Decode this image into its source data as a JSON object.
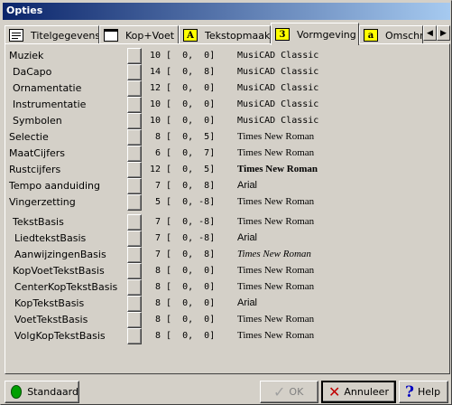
{
  "window": {
    "title": "Opties"
  },
  "tabs": [
    {
      "label": "Titelgegevens",
      "icon": "book-icon"
    },
    {
      "label": "Kop+Voet",
      "icon": "folder-icon"
    },
    {
      "label": "Tekstopmaak",
      "icon": "text-icon",
      "glyph": "A"
    },
    {
      "label": "Vormgeving",
      "icon": "layout-icon",
      "glyph": "3",
      "active": true
    },
    {
      "label": "Omschrij",
      "icon": "description-icon",
      "glyph": "a"
    }
  ],
  "rows": [
    {
      "name": "muziek",
      "label": "Muziek",
      "size": "10",
      "bracket": "[  0,  0]",
      "font": "MusiCAD Classic",
      "style": "mono"
    },
    {
      "name": "dacapo",
      "label": "DaCapo",
      "size": "14",
      "bracket": "[  0,  8]",
      "font": "MusiCAD Classic",
      "style": "mono"
    },
    {
      "name": "ornamentatie",
      "label": "Ornamentatie",
      "size": "12",
      "bracket": "[  0,  0]",
      "font": "MusiCAD Classic",
      "style": "mono"
    },
    {
      "name": "instrumentatie",
      "label": "Instrumentatie",
      "size": "10",
      "bracket": "[  0,  0]",
      "font": "MusiCAD Classic",
      "style": "mono"
    },
    {
      "name": "symbolen",
      "label": "Symbolen",
      "size": "10",
      "bracket": "[  0,  0]",
      "font": "MusiCAD Classic",
      "style": "mono"
    },
    {
      "name": "selectie",
      "label": "Selectie",
      "size": "8",
      "bracket": "[  0,  5]",
      "font": "Times New Roman",
      "style": "serif"
    },
    {
      "name": "maatcijfers",
      "label": "MaatCijfers",
      "size": "6",
      "bracket": "[  0,  7]",
      "font": "Times New Roman",
      "style": "serif"
    },
    {
      "name": "rustcijfers",
      "label": "Rustcijfers",
      "size": "12",
      "bracket": "[  0,  5]",
      "font": "Times New Roman",
      "style": "serif-bold"
    },
    {
      "name": "tempo-aanduiding",
      "label": "Tempo aanduiding",
      "size": "7",
      "bracket": "[  0,  8]",
      "font": "Arial",
      "style": "sans"
    },
    {
      "name": "vingerzetting",
      "label": "Vingerzetting",
      "size": "5",
      "bracket": "[  0, -8]",
      "font": "Times New Roman",
      "style": "serif"
    },
    {
      "name": "tekstbasis",
      "label": "TekstBasis",
      "size": "7",
      "bracket": "[  0, -8]",
      "font": "Times New Roman",
      "style": "serif"
    },
    {
      "name": "liedtekstbasis",
      "label": "LiedtekstBasis",
      "size": "7",
      "bracket": "[  0, -8]",
      "font": "Arial",
      "style": "sans"
    },
    {
      "name": "aanwijzingenbasis",
      "label": "AanwijzingenBasis",
      "size": "7",
      "bracket": "[  0,  8]",
      "font": "Times New Roman",
      "style": "serif-italic"
    },
    {
      "name": "kopvoettekstbasis",
      "label": "KopVoetTekstBasis",
      "size": "8",
      "bracket": "[  0,  0]",
      "font": "Times New Roman",
      "style": "serif"
    },
    {
      "name": "centerkoptekstbasis",
      "label": "CenterKopTekstBasis",
      "size": "8",
      "bracket": "[  0,  0]",
      "font": "Times New Roman",
      "style": "serif"
    },
    {
      "name": "koptekstbasis",
      "label": "KopTekstBasis",
      "size": "8",
      "bracket": "[  0,  0]",
      "font": "Arial",
      "style": "sans"
    },
    {
      "name": "voettekstbasis",
      "label": "VoetTekstBasis",
      "size": "8",
      "bracket": "[  0,  0]",
      "font": "Times New Roman",
      "style": "serif"
    },
    {
      "name": "volgkoptekstbasis",
      "label": "VolgKopTekstBasis",
      "size": "8",
      "bracket": "[  0,  0]",
      "font": "Times New Roman",
      "style": "serif"
    }
  ],
  "buttons": {
    "standaard": "Standaard",
    "ok": "OK",
    "annuleer": "Annuleer",
    "help": "Help"
  },
  "colors": {
    "face": "#d4d0c8",
    "title_start": "#0a246a",
    "title_end": "#a6caf0",
    "standaard_dot": "#00a000",
    "annuleer_x": "#c00000",
    "help_q": "#0000c0"
  }
}
